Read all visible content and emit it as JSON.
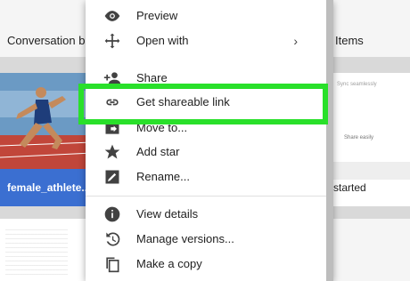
{
  "background_cards": {
    "conversation_label": "Conversation b...",
    "items_label": "Items",
    "athlete_label": "female_athlete...",
    "getstarted_label": "started",
    "getstarted_text1": "Sync seamlessly",
    "getstarted_text2": "Share easily"
  },
  "menu": {
    "items": [
      {
        "label": "Preview",
        "icon": "eye-icon"
      },
      {
        "label": "Open with",
        "icon": "move-arrows-icon",
        "has_submenu": true
      },
      {
        "label": "Share",
        "icon": "add-person-icon"
      },
      {
        "label": "Get shareable link",
        "icon": "link-icon",
        "highlighted": true
      },
      {
        "label": "Move to...",
        "icon": "folder-move-icon"
      },
      {
        "label": "Add star",
        "icon": "star-icon"
      },
      {
        "label": "Rename...",
        "icon": "pencil-icon"
      },
      {
        "label": "View details",
        "icon": "info-icon"
      },
      {
        "label": "Manage versions...",
        "icon": "history-icon"
      },
      {
        "label": "Make a copy",
        "icon": "copy-icon"
      }
    ],
    "submenu_glyph": "›"
  },
  "colors": {
    "highlight": "#29e02a",
    "accent_blue": "#3b6fd1",
    "icon": "#424242"
  }
}
